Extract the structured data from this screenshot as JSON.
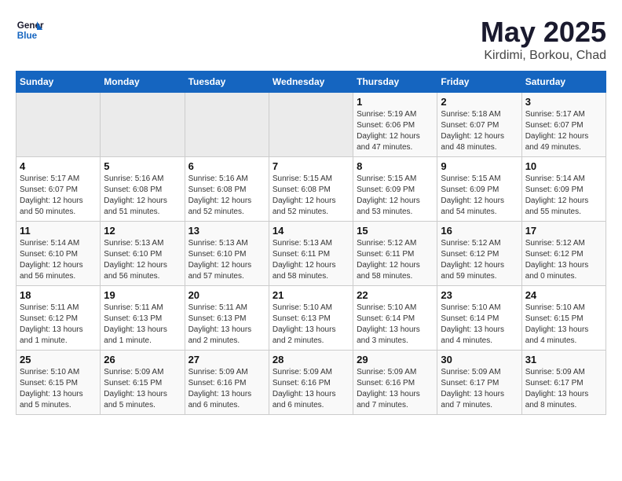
{
  "header": {
    "logo_line1": "General",
    "logo_line2": "Blue",
    "title": "May 2025",
    "subtitle": "Kirdimi, Borkou, Chad"
  },
  "weekdays": [
    "Sunday",
    "Monday",
    "Tuesday",
    "Wednesday",
    "Thursday",
    "Friday",
    "Saturday"
  ],
  "weeks": [
    [
      {
        "day": "",
        "info": ""
      },
      {
        "day": "",
        "info": ""
      },
      {
        "day": "",
        "info": ""
      },
      {
        "day": "",
        "info": ""
      },
      {
        "day": "1",
        "info": "Sunrise: 5:19 AM\nSunset: 6:06 PM\nDaylight: 12 hours\nand 47 minutes."
      },
      {
        "day": "2",
        "info": "Sunrise: 5:18 AM\nSunset: 6:07 PM\nDaylight: 12 hours\nand 48 minutes."
      },
      {
        "day": "3",
        "info": "Sunrise: 5:17 AM\nSunset: 6:07 PM\nDaylight: 12 hours\nand 49 minutes."
      }
    ],
    [
      {
        "day": "4",
        "info": "Sunrise: 5:17 AM\nSunset: 6:07 PM\nDaylight: 12 hours\nand 50 minutes."
      },
      {
        "day": "5",
        "info": "Sunrise: 5:16 AM\nSunset: 6:08 PM\nDaylight: 12 hours\nand 51 minutes."
      },
      {
        "day": "6",
        "info": "Sunrise: 5:16 AM\nSunset: 6:08 PM\nDaylight: 12 hours\nand 52 minutes."
      },
      {
        "day": "7",
        "info": "Sunrise: 5:15 AM\nSunset: 6:08 PM\nDaylight: 12 hours\nand 52 minutes."
      },
      {
        "day": "8",
        "info": "Sunrise: 5:15 AM\nSunset: 6:09 PM\nDaylight: 12 hours\nand 53 minutes."
      },
      {
        "day": "9",
        "info": "Sunrise: 5:15 AM\nSunset: 6:09 PM\nDaylight: 12 hours\nand 54 minutes."
      },
      {
        "day": "10",
        "info": "Sunrise: 5:14 AM\nSunset: 6:09 PM\nDaylight: 12 hours\nand 55 minutes."
      }
    ],
    [
      {
        "day": "11",
        "info": "Sunrise: 5:14 AM\nSunset: 6:10 PM\nDaylight: 12 hours\nand 56 minutes."
      },
      {
        "day": "12",
        "info": "Sunrise: 5:13 AM\nSunset: 6:10 PM\nDaylight: 12 hours\nand 56 minutes."
      },
      {
        "day": "13",
        "info": "Sunrise: 5:13 AM\nSunset: 6:10 PM\nDaylight: 12 hours\nand 57 minutes."
      },
      {
        "day": "14",
        "info": "Sunrise: 5:13 AM\nSunset: 6:11 PM\nDaylight: 12 hours\nand 58 minutes."
      },
      {
        "day": "15",
        "info": "Sunrise: 5:12 AM\nSunset: 6:11 PM\nDaylight: 12 hours\nand 58 minutes."
      },
      {
        "day": "16",
        "info": "Sunrise: 5:12 AM\nSunset: 6:12 PM\nDaylight: 12 hours\nand 59 minutes."
      },
      {
        "day": "17",
        "info": "Sunrise: 5:12 AM\nSunset: 6:12 PM\nDaylight: 13 hours\nand 0 minutes."
      }
    ],
    [
      {
        "day": "18",
        "info": "Sunrise: 5:11 AM\nSunset: 6:12 PM\nDaylight: 13 hours\nand 1 minute."
      },
      {
        "day": "19",
        "info": "Sunrise: 5:11 AM\nSunset: 6:13 PM\nDaylight: 13 hours\nand 1 minute."
      },
      {
        "day": "20",
        "info": "Sunrise: 5:11 AM\nSunset: 6:13 PM\nDaylight: 13 hours\nand 2 minutes."
      },
      {
        "day": "21",
        "info": "Sunrise: 5:10 AM\nSunset: 6:13 PM\nDaylight: 13 hours\nand 2 minutes."
      },
      {
        "day": "22",
        "info": "Sunrise: 5:10 AM\nSunset: 6:14 PM\nDaylight: 13 hours\nand 3 minutes."
      },
      {
        "day": "23",
        "info": "Sunrise: 5:10 AM\nSunset: 6:14 PM\nDaylight: 13 hours\nand 4 minutes."
      },
      {
        "day": "24",
        "info": "Sunrise: 5:10 AM\nSunset: 6:15 PM\nDaylight: 13 hours\nand 4 minutes."
      }
    ],
    [
      {
        "day": "25",
        "info": "Sunrise: 5:10 AM\nSunset: 6:15 PM\nDaylight: 13 hours\nand 5 minutes."
      },
      {
        "day": "26",
        "info": "Sunrise: 5:09 AM\nSunset: 6:15 PM\nDaylight: 13 hours\nand 5 minutes."
      },
      {
        "day": "27",
        "info": "Sunrise: 5:09 AM\nSunset: 6:16 PM\nDaylight: 13 hours\nand 6 minutes."
      },
      {
        "day": "28",
        "info": "Sunrise: 5:09 AM\nSunset: 6:16 PM\nDaylight: 13 hours\nand 6 minutes."
      },
      {
        "day": "29",
        "info": "Sunrise: 5:09 AM\nSunset: 6:16 PM\nDaylight: 13 hours\nand 7 minutes."
      },
      {
        "day": "30",
        "info": "Sunrise: 5:09 AM\nSunset: 6:17 PM\nDaylight: 13 hours\nand 7 minutes."
      },
      {
        "day": "31",
        "info": "Sunrise: 5:09 AM\nSunset: 6:17 PM\nDaylight: 13 hours\nand 8 minutes."
      }
    ]
  ]
}
